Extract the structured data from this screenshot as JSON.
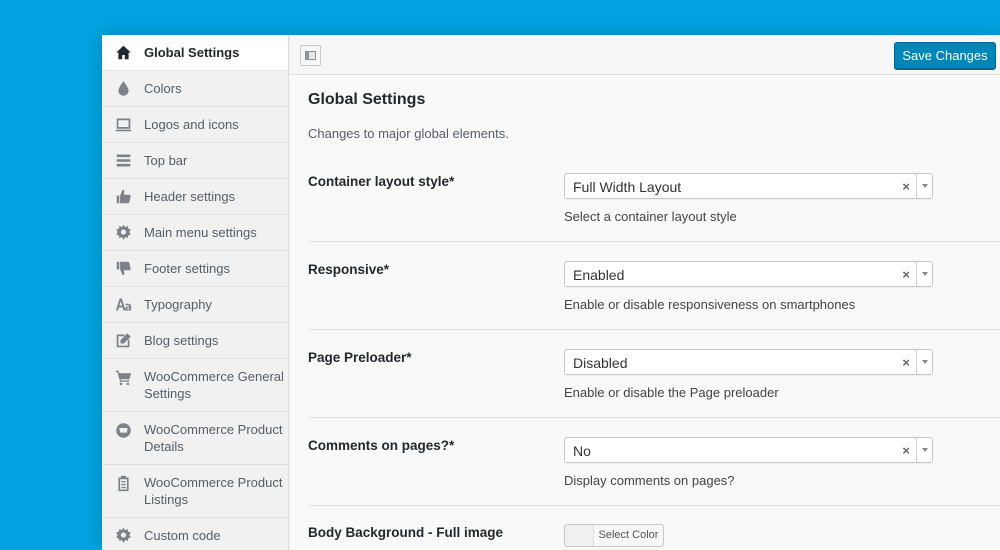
{
  "sidebar": {
    "items": [
      {
        "label": "Global Settings",
        "icon": "home-icon"
      },
      {
        "label": "Colors",
        "icon": "droplet-icon"
      },
      {
        "label": "Logos and icons",
        "icon": "laptop-icon"
      },
      {
        "label": "Top bar",
        "icon": "menu-bars-icon"
      },
      {
        "label": "Header settings",
        "icon": "thumbs-up-icon"
      },
      {
        "label": "Main menu settings",
        "icon": "gear-icon"
      },
      {
        "label": "Footer settings",
        "icon": "thumbs-down-icon"
      },
      {
        "label": "Typography",
        "icon": "typography-icon"
      },
      {
        "label": "Blog settings",
        "icon": "edit-icon"
      },
      {
        "label": "WooCommerce General Settings",
        "icon": "cart-icon"
      },
      {
        "label": "WooCommerce Product Details",
        "icon": "basket-icon"
      },
      {
        "label": "WooCommerce Product Listings",
        "icon": "clipboard-icon"
      },
      {
        "label": "Custom code",
        "icon": "gear-icon"
      }
    ]
  },
  "toolbar": {
    "save_label": "Save Changes"
  },
  "page": {
    "title": "Global Settings",
    "description": "Changes to major global elements."
  },
  "fields": {
    "container": {
      "label": "Container layout style*",
      "value": "Full Width Layout",
      "clear": "×",
      "description": "Select a container layout style"
    },
    "responsive": {
      "label": "Responsive*",
      "value": "Enabled",
      "clear": "×",
      "description": "Enable or disable responsiveness on smartphones"
    },
    "preloader": {
      "label": "Page Preloader*",
      "value": "Disabled",
      "clear": "×",
      "description": "Enable or disable the Page preloader"
    },
    "comments": {
      "label": "Comments on pages?*",
      "value": "No",
      "clear": "×",
      "description": "Display comments on pages?"
    },
    "body_bg": {
      "label": "Body Background - Full image",
      "button": "Select Color"
    }
  },
  "colors": {
    "background": "#00a3e0",
    "accent": "#0085ba"
  }
}
